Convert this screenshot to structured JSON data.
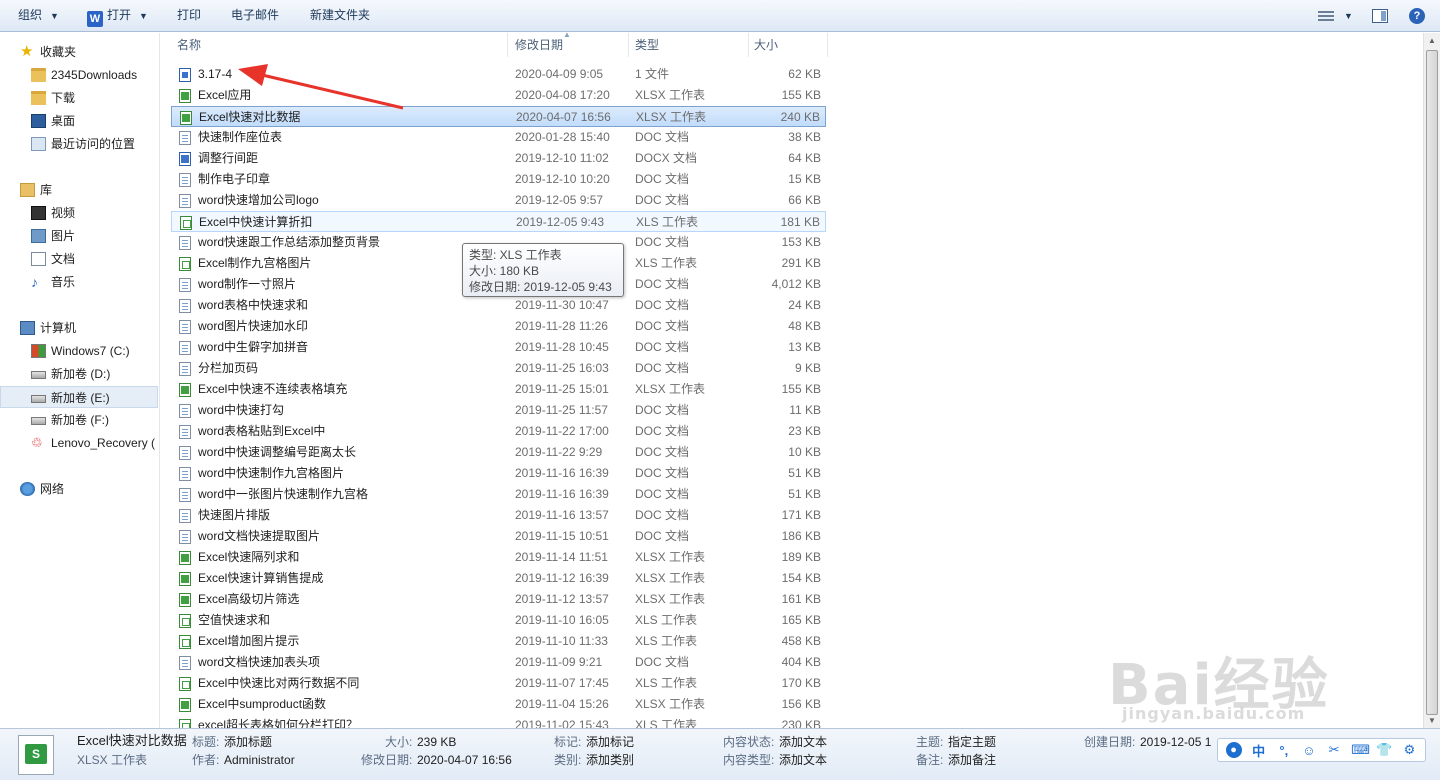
{
  "toolbar": {
    "organize": "组织",
    "open": "打开",
    "open_icon": "W",
    "print": "打印",
    "email": "电子邮件",
    "new_folder": "新建文件夹",
    "help": "?"
  },
  "sidebar": {
    "favorites": "收藏夹",
    "fav_items": [
      "2345Downloads",
      "下载",
      "桌面",
      "最近访问的位置"
    ],
    "libraries": "库",
    "lib_items": [
      "视频",
      "图片",
      "文档",
      "音乐"
    ],
    "computer": "计算机",
    "drives": [
      "Windows7 (C:)",
      "新加卷 (D:)",
      "新加卷 (E:)",
      "新加卷 (F:)",
      "Lenovo_Recovery ("
    ],
    "network": "网络"
  },
  "columns": {
    "name": "名称",
    "date": "修改日期",
    "type": "类型",
    "size": "大小"
  },
  "files": [
    {
      "name": "3.17-4",
      "date": "2020-04-09 9:05",
      "type": "1 文件",
      "size": "62 KB",
      "icon": "wps"
    },
    {
      "name": "Excel应用",
      "date": "2020-04-08 17:20",
      "type": "XLSX 工作表",
      "size": "155 KB",
      "icon": "xlsx"
    },
    {
      "name": "Excel快速对比数据",
      "date": "2020-04-07 16:56",
      "type": "XLSX 工作表",
      "size": "240 KB",
      "icon": "xlsx"
    },
    {
      "name": "快速制作座位表",
      "date": "2020-01-28 15:40",
      "type": "DOC 文档",
      "size": "38 KB",
      "icon": "doc"
    },
    {
      "name": "调整行间距",
      "date": "2019-12-10 11:02",
      "type": "DOCX 文档",
      "size": "64 KB",
      "icon": "docx"
    },
    {
      "name": "制作电子印章",
      "date": "2019-12-10 10:20",
      "type": "DOC 文档",
      "size": "15 KB",
      "icon": "doc"
    },
    {
      "name": "word快速增加公司logo",
      "date": "2019-12-05 9:57",
      "type": "DOC 文档",
      "size": "66 KB",
      "icon": "doc"
    },
    {
      "name": "Excel中快速计算折扣",
      "date": "2019-12-05 9:43",
      "type": "XLS 工作表",
      "size": "181 KB",
      "icon": "xls"
    },
    {
      "name": "word快速跟工作总结添加整页背景",
      "date": "",
      "type": "DOC 文档",
      "size": "153 KB",
      "icon": "doc"
    },
    {
      "name": "Excel制作九宫格图片",
      "date": "",
      "type": "XLS 工作表",
      "size": "291 KB",
      "icon": "xls"
    },
    {
      "name": "word制作一寸照片",
      "date": "",
      "type": "DOC 文档",
      "size": "4,012 KB",
      "icon": "doc"
    },
    {
      "name": "word表格中快速求和",
      "date": "2019-11-30 10:47",
      "type": "DOC 文档",
      "size": "24 KB",
      "icon": "doc"
    },
    {
      "name": "word图片快速加水印",
      "date": "2019-11-28 11:26",
      "type": "DOC 文档",
      "size": "48 KB",
      "icon": "doc"
    },
    {
      "name": "word中生僻字加拼音",
      "date": "2019-11-28 10:45",
      "type": "DOC 文档",
      "size": "13 KB",
      "icon": "doc"
    },
    {
      "name": "分栏加页码",
      "date": "2019-11-25 16:03",
      "type": "DOC 文档",
      "size": "9 KB",
      "icon": "doc"
    },
    {
      "name": "Excel中快速不连续表格填充",
      "date": "2019-11-25 15:01",
      "type": "XLSX 工作表",
      "size": "155 KB",
      "icon": "xlsx"
    },
    {
      "name": "word中快速打勾",
      "date": "2019-11-25 11:57",
      "type": "DOC 文档",
      "size": "11 KB",
      "icon": "doc"
    },
    {
      "name": "word表格粘贴到Excel中",
      "date": "2019-11-22 17:00",
      "type": "DOC 文档",
      "size": "23 KB",
      "icon": "doc"
    },
    {
      "name": "word中快速调整编号距离太长",
      "date": "2019-11-22 9:29",
      "type": "DOC 文档",
      "size": "10 KB",
      "icon": "doc"
    },
    {
      "name": "word中快速制作九宫格图片",
      "date": "2019-11-16 16:39",
      "type": "DOC 文档",
      "size": "51 KB",
      "icon": "doc"
    },
    {
      "name": "word中一张图片快速制作九宫格",
      "date": "2019-11-16 16:39",
      "type": "DOC 文档",
      "size": "51 KB",
      "icon": "doc"
    },
    {
      "name": "快速图片排版",
      "date": "2019-11-16 13:57",
      "type": "DOC 文档",
      "size": "171 KB",
      "icon": "doc"
    },
    {
      "name": "word文档快速提取图片",
      "date": "2019-11-15 10:51",
      "type": "DOC 文档",
      "size": "186 KB",
      "icon": "doc"
    },
    {
      "name": "Excel快速隔列求和",
      "date": "2019-11-14 11:51",
      "type": "XLSX 工作表",
      "size": "189 KB",
      "icon": "xlsx"
    },
    {
      "name": "Excel快速计算销售提成",
      "date": "2019-11-12 16:39",
      "type": "XLSX 工作表",
      "size": "154 KB",
      "icon": "xlsx"
    },
    {
      "name": "Excel高级切片筛选",
      "date": "2019-11-12 13:57",
      "type": "XLSX 工作表",
      "size": "161 KB",
      "icon": "xlsx"
    },
    {
      "name": "空值快速求和",
      "date": "2019-11-10 16:05",
      "type": "XLS 工作表",
      "size": "165 KB",
      "icon": "xls"
    },
    {
      "name": "Excel增加图片提示",
      "date": "2019-11-10 11:33",
      "type": "XLS 工作表",
      "size": "458 KB",
      "icon": "xls"
    },
    {
      "name": "word文档快速加表头项",
      "date": "2019-11-09 9:21",
      "type": "DOC 文档",
      "size": "404 KB",
      "icon": "doc"
    },
    {
      "name": "Excel中快速比对两行数据不同",
      "date": "2019-11-07 17:45",
      "type": "XLS 工作表",
      "size": "170 KB",
      "icon": "xls"
    },
    {
      "name": "Excel中sumproduct函数",
      "date": "2019-11-04 15:26",
      "type": "XLSX 工作表",
      "size": "156 KB",
      "icon": "xlsx"
    },
    {
      "name": "excel超长表格如何分栏打印？",
      "date": "2019-11-02 15:43",
      "type": "XLS 工作表",
      "size": "230 KB",
      "icon": "xls"
    }
  ],
  "selected_index": 2,
  "hover_index": 7,
  "tooltip": {
    "line1": "类型: XLS 工作表",
    "line2": "大小: 180 KB",
    "line3": "修改日期: 2019-12-05 9:43"
  },
  "details": {
    "name": "Excel快速对比数据",
    "type": "XLSX 工作表",
    "title_label": "标题:",
    "title_value": "添加标题",
    "author_label": "作者:",
    "author_value": "Administrator",
    "size_label": "大小:",
    "size_value": "239 KB",
    "modified_label": "修改日期:",
    "modified_value": "2020-04-07 16:56",
    "tags_label": "标记:",
    "tags_value": "添加标记",
    "category_label": "类别:",
    "category_value": "添加类别",
    "content_status_label": "内容状态:",
    "content_status_value": "添加文本",
    "content_type_label": "内容类型:",
    "content_type_value": "添加文本",
    "subject_label": "主题:",
    "subject_value": "指定主题",
    "comments_label": "备注:",
    "comments_value": "添加备注",
    "created_label": "创建日期:",
    "created_value": "2019-12-05 1"
  },
  "ime": [
    "中",
    "°,",
    "☺",
    "✂",
    "⌨",
    "👕",
    "⚙"
  ],
  "watermark": {
    "logo": "Bai经验",
    "url": "jingyan.baidu.com"
  },
  "colors": {
    "annotation_arrow": "#e8332a",
    "selection": "#c1dcfc",
    "accent": "#2b63c6"
  }
}
